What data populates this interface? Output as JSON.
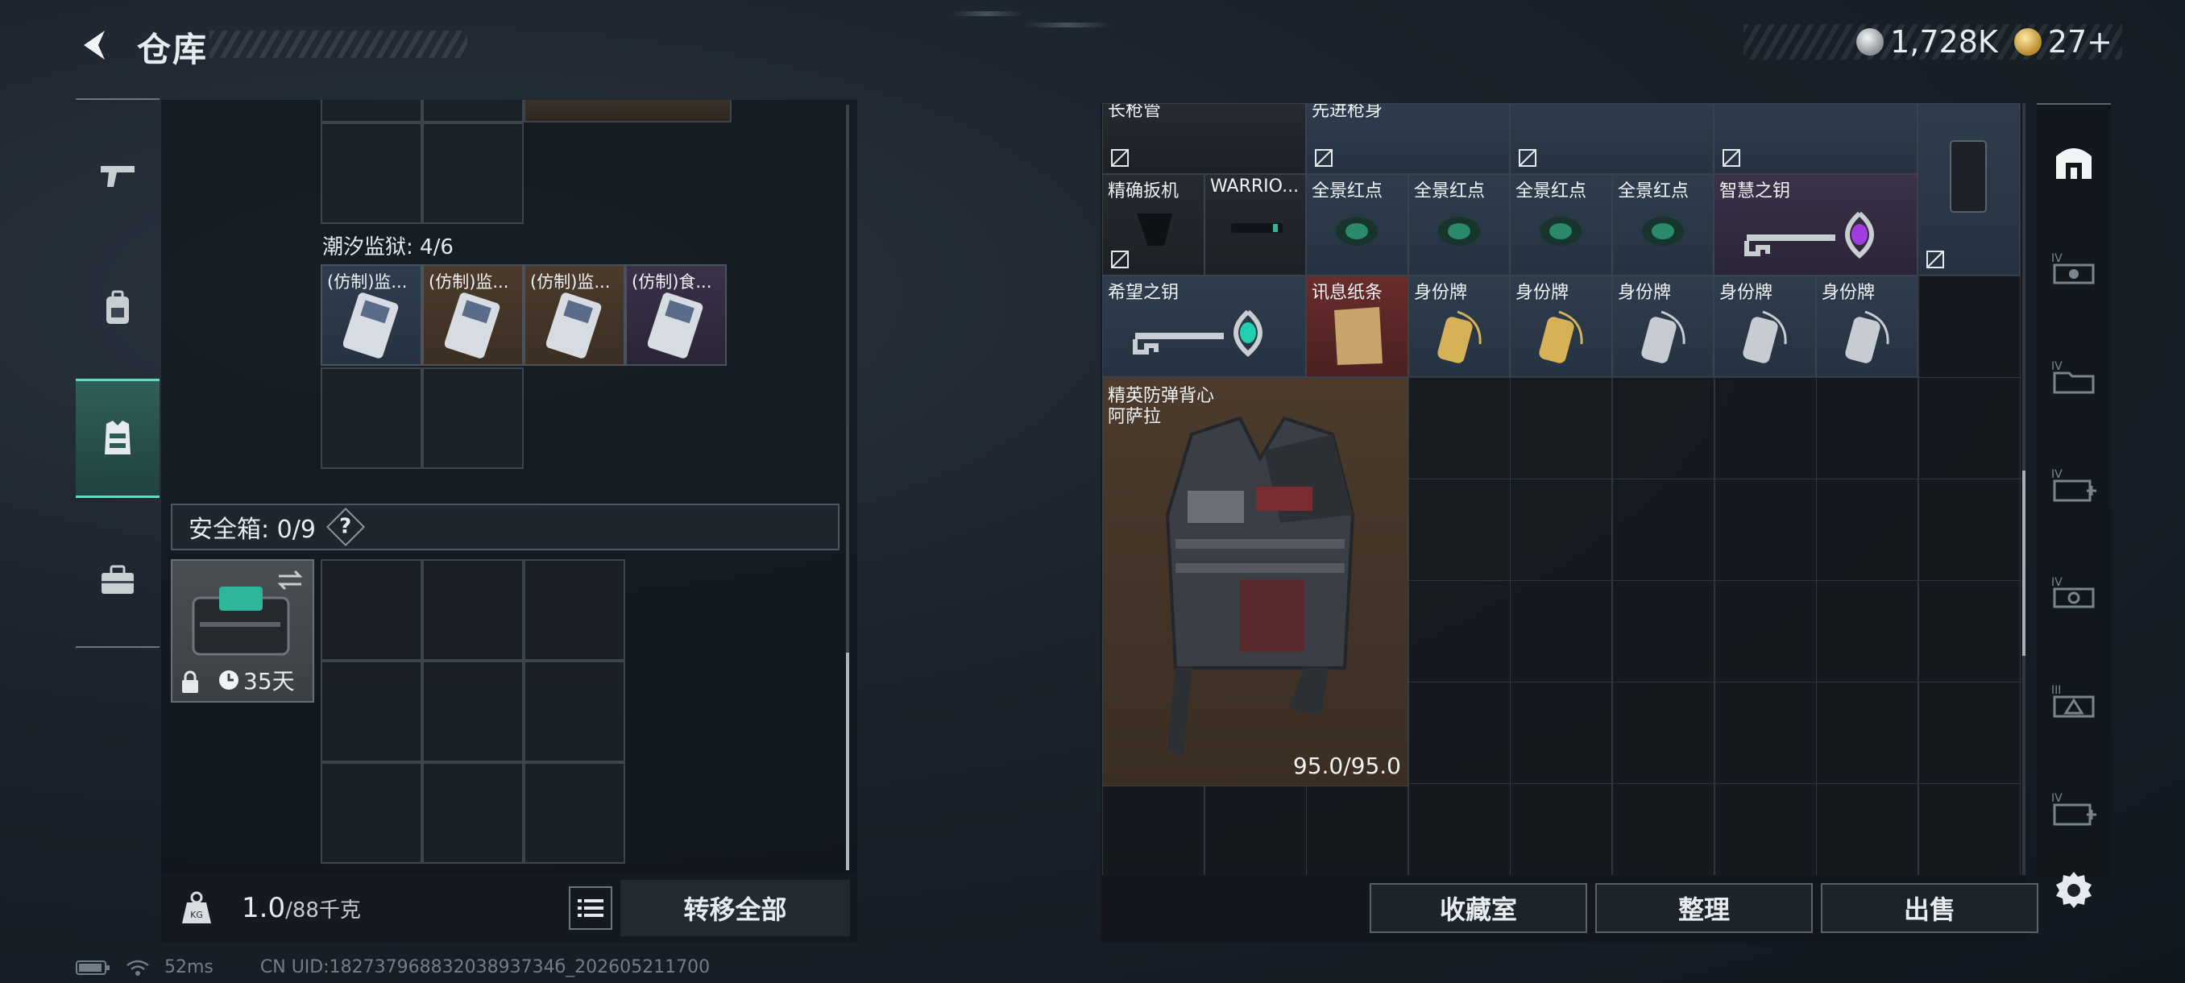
{
  "header": {
    "title": "仓库",
    "currencies": [
      {
        "icon": "silver-coin-icon",
        "value": "1,728K"
      },
      {
        "icon": "gold-coin-icon",
        "value": "27+"
      }
    ]
  },
  "left_nav": {
    "items": [
      {
        "icon": "gun-icon"
      },
      {
        "icon": "backpack-icon"
      },
      {
        "icon": "vest-icon",
        "active": true
      },
      {
        "icon": "toolbox-icon"
      }
    ]
  },
  "left_panel": {
    "prison_label": "潮汐监狱: 4/6",
    "prison_items": [
      {
        "label": "(仿制)监..."
      },
      {
        "label": "(仿制)监..."
      },
      {
        "label": "(仿制)监..."
      },
      {
        "label": "(仿制)食..."
      }
    ],
    "safe_label": "安全箱: 0/9",
    "help_label": "?",
    "safebox_timer": "35天",
    "weight_current": "1.0",
    "weight_max": "/88千克",
    "transfer_all": "转移全部"
  },
  "right_panel": {
    "partial_labels": [
      "长枪管",
      "先进枪身"
    ],
    "row1": [
      {
        "label": "精确扳机"
      },
      {
        "label": "WARRIO..."
      },
      {
        "label": "全景红点"
      },
      {
        "label": "全景红点"
      },
      {
        "label": "全景红点"
      },
      {
        "label": "全景红点"
      },
      {
        "label": "智慧之钥"
      }
    ],
    "row2": [
      {
        "label": "希望之钥"
      },
      {
        "label": "讯息纸条"
      },
      {
        "label": "身份牌"
      },
      {
        "label": "身份牌"
      },
      {
        "label": "身份牌"
      },
      {
        "label": "身份牌"
      },
      {
        "label": "身份牌"
      }
    ],
    "vest": {
      "label_line1": "精英防弹背心",
      "label_line2": "阿萨拉",
      "durability": "95.0/95.0"
    },
    "buttons": {
      "collection": "收藏室",
      "organize": "整理",
      "sell": "出售"
    }
  },
  "right_nav": {
    "items": [
      {
        "icon": "home-vault-icon"
      },
      {
        "icon": "tier4-rifle-icon"
      },
      {
        "icon": "tier4-folder-icon"
      },
      {
        "icon": "tier4-medkit-icon"
      },
      {
        "icon": "tier4-scope-icon"
      },
      {
        "icon": "tier3-warning-icon"
      },
      {
        "icon": "tier4-medical-icon"
      }
    ]
  },
  "status_bar": {
    "ping": "52ms",
    "uid": "CN UID:18273796883203893734б_202605211700"
  }
}
